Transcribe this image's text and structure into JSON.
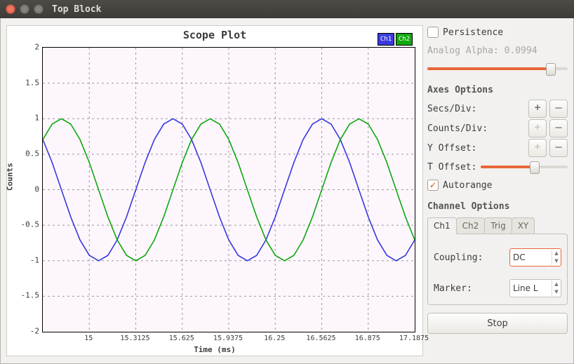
{
  "window": {
    "title": "Top Block"
  },
  "chart_data": {
    "type": "line",
    "title": "Scope Plot",
    "xlabel": "Time (ms)",
    "ylabel": "Counts",
    "xlim": [
      14.6875,
      17.1875
    ],
    "ylim": [
      -2,
      2
    ],
    "xticks": [
      15,
      15.3125,
      15.625,
      15.9375,
      16.25,
      16.5625,
      16.875,
      17.1875
    ],
    "yticks": [
      -2,
      -1.5,
      -1,
      -0.5,
      0,
      0.5,
      1,
      1.5,
      2
    ],
    "x": [
      14.6875,
      14.75,
      14.8125,
      14.875,
      14.9375,
      15,
      15.0625,
      15.125,
      15.1875,
      15.25,
      15.3125,
      15.375,
      15.4375,
      15.5,
      15.5625,
      15.625,
      15.6875,
      15.75,
      15.8125,
      15.875,
      15.9375,
      16,
      16.0625,
      16.125,
      16.1875,
      16.25,
      16.3125,
      16.375,
      16.4375,
      16.5,
      16.5625,
      16.625,
      16.6875,
      16.75,
      16.8125,
      16.875,
      16.9375,
      17,
      17.0625,
      17.125,
      17.1875
    ],
    "series": [
      {
        "name": "Ch1",
        "color": "#3a3ae0",
        "values": [
          0.707,
          0.383,
          0,
          -0.383,
          -0.707,
          -0.924,
          -1,
          -0.924,
          -0.707,
          -0.383,
          0,
          0.383,
          0.707,
          0.924,
          1,
          0.924,
          0.707,
          0.383,
          0,
          -0.383,
          -0.707,
          -0.924,
          -1,
          -0.924,
          -0.707,
          -0.383,
          0,
          0.383,
          0.707,
          0.924,
          1,
          0.924,
          0.707,
          0.383,
          0,
          -0.383,
          -0.707,
          -0.924,
          -1,
          -0.924,
          -0.707
        ]
      },
      {
        "name": "Ch2",
        "color": "#10a810",
        "values": [
          0.707,
          0.924,
          1,
          0.924,
          0.707,
          0.383,
          0,
          -0.383,
          -0.707,
          -0.924,
          -1,
          -0.924,
          -0.707,
          -0.383,
          0,
          0.383,
          0.707,
          0.924,
          1,
          0.924,
          0.707,
          0.383,
          0,
          -0.383,
          -0.707,
          -0.924,
          -1,
          -0.924,
          -0.707,
          -0.383,
          0,
          0.383,
          0.707,
          0.924,
          1,
          0.924,
          0.707,
          0.383,
          0,
          -0.383,
          -0.707
        ]
      }
    ],
    "legend": {
      "position": "top-right"
    }
  },
  "panel": {
    "persistence": {
      "label": "Persistence",
      "checked": false
    },
    "analog_alpha": {
      "label": "Analog Alpha:",
      "value": "0.0994",
      "slider": 0.88
    },
    "axes_header": "Axes Options",
    "secs_div": "Secs/Div:",
    "counts_div": "Counts/Div:",
    "y_offset": "Y Offset:",
    "t_offset": {
      "label": "T Offset:",
      "slider": 0.62
    },
    "autorange": {
      "label": "Autorange",
      "checked": true
    },
    "channel_header": "Channel Options",
    "tabs": {
      "items": [
        "Ch1",
        "Ch2",
        "Trig",
        "XY"
      ],
      "active": 0
    },
    "coupling": {
      "label": "Coupling:",
      "value": "DC"
    },
    "marker": {
      "label": "Marker:",
      "value": "Line L"
    },
    "stop": "Stop",
    "plus": "+",
    "minus": "–"
  }
}
